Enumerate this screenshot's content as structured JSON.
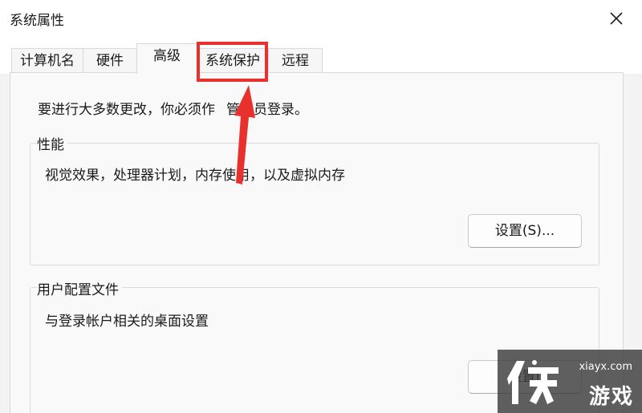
{
  "window": {
    "title": "系统属性"
  },
  "tabs": [
    {
      "label": "计算机名",
      "active": false
    },
    {
      "label": "硬件",
      "active": false
    },
    {
      "label": "高级",
      "active": true
    },
    {
      "label": "系统保护",
      "active": false,
      "highlighted": true
    },
    {
      "label": "远程",
      "active": false
    }
  ],
  "advanced": {
    "admin_note": "要进行大多数更改，你必须作",
    "admin_note_tail": "管理员登录。",
    "performance": {
      "label": "性能",
      "description": "视觉效果，处理器计划，内存使用，以及虚拟内存",
      "settings_button": "设置(S)..."
    },
    "user_profiles": {
      "label": "用户配置文件",
      "description": "与登录帐户相关的桌面设置",
      "settings_button": "设置("
    }
  },
  "watermark": {
    "url": "xiayx.com",
    "name": "游戏"
  },
  "colors": {
    "highlight": "#e8302c",
    "arrow": "#e8302c",
    "window_bg": "#f9f9f9"
  },
  "icons": {
    "close": "close-icon",
    "watermark_logo": "xia-logo"
  }
}
